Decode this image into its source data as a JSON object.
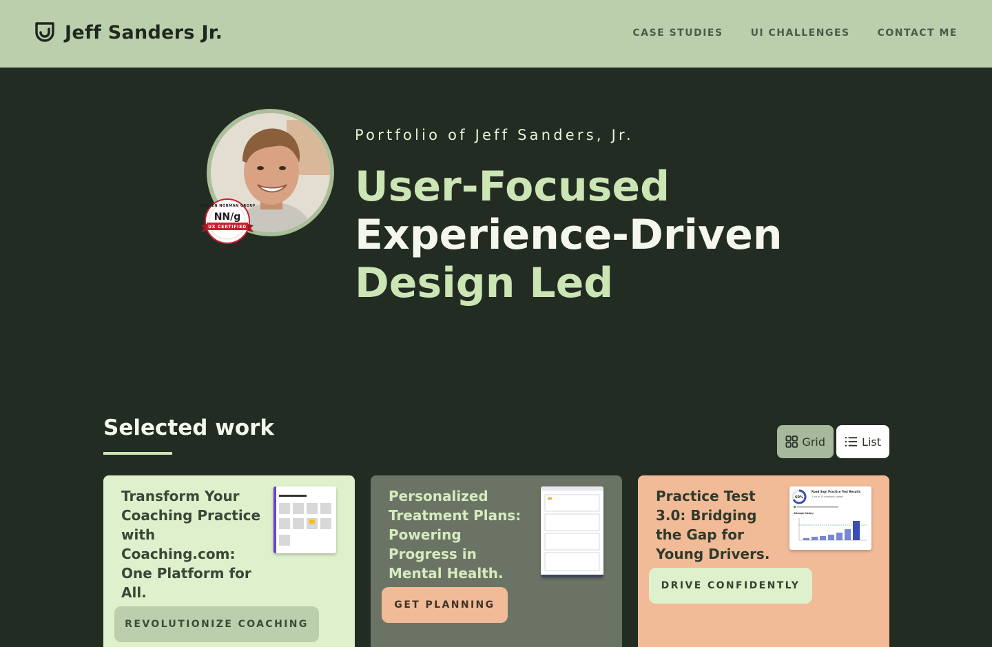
{
  "header": {
    "logo_text": "Jeff Sanders Jr.",
    "logo_icon": "shield-smile-icon",
    "nav": [
      "CASE STUDIES",
      "UI CHALLENGES",
      "CONTACT ME"
    ]
  },
  "hero": {
    "kicker": "Portfolio of Jeff Sanders, Jr.",
    "headline": [
      "User-Focused",
      "Experience-Driven",
      "Design Led"
    ],
    "badge": {
      "org": "NIELSEN NORMAN GROUP",
      "mark": "NN/g",
      "ribbon": "UX CERTIFIED"
    }
  },
  "work": {
    "title": "Selected work",
    "toggle": {
      "grid": "Grid",
      "list": "List",
      "selected": "grid"
    },
    "cards": [
      {
        "title": "Transform Your Coaching Practice with Coaching.com: One Platform for All.",
        "cta": "REVOLUTIONIZE COACHING"
      },
      {
        "title": "Personalized Treatment Plans: Powering Progress in Mental Health.",
        "cta": "GET PLANNING"
      },
      {
        "title": "Practice Test 3.0: Bridging the Gap for Young Drivers.",
        "cta": "DRIVE CONFIDENTLY",
        "thumb": {
          "title": "Road Sign Practice Test Results",
          "score": "60%",
          "subtitle": "3 out of 25 questions correct",
          "chart_title": "Attempt History"
        }
      }
    ]
  },
  "colors": {
    "header_bg": "#bccfad",
    "page_bg": "#232c22",
    "accent_light": "#cbe5b4",
    "card_green": "#def1cc",
    "card_gray": "#6b7464",
    "card_peach": "#f1bb98"
  }
}
